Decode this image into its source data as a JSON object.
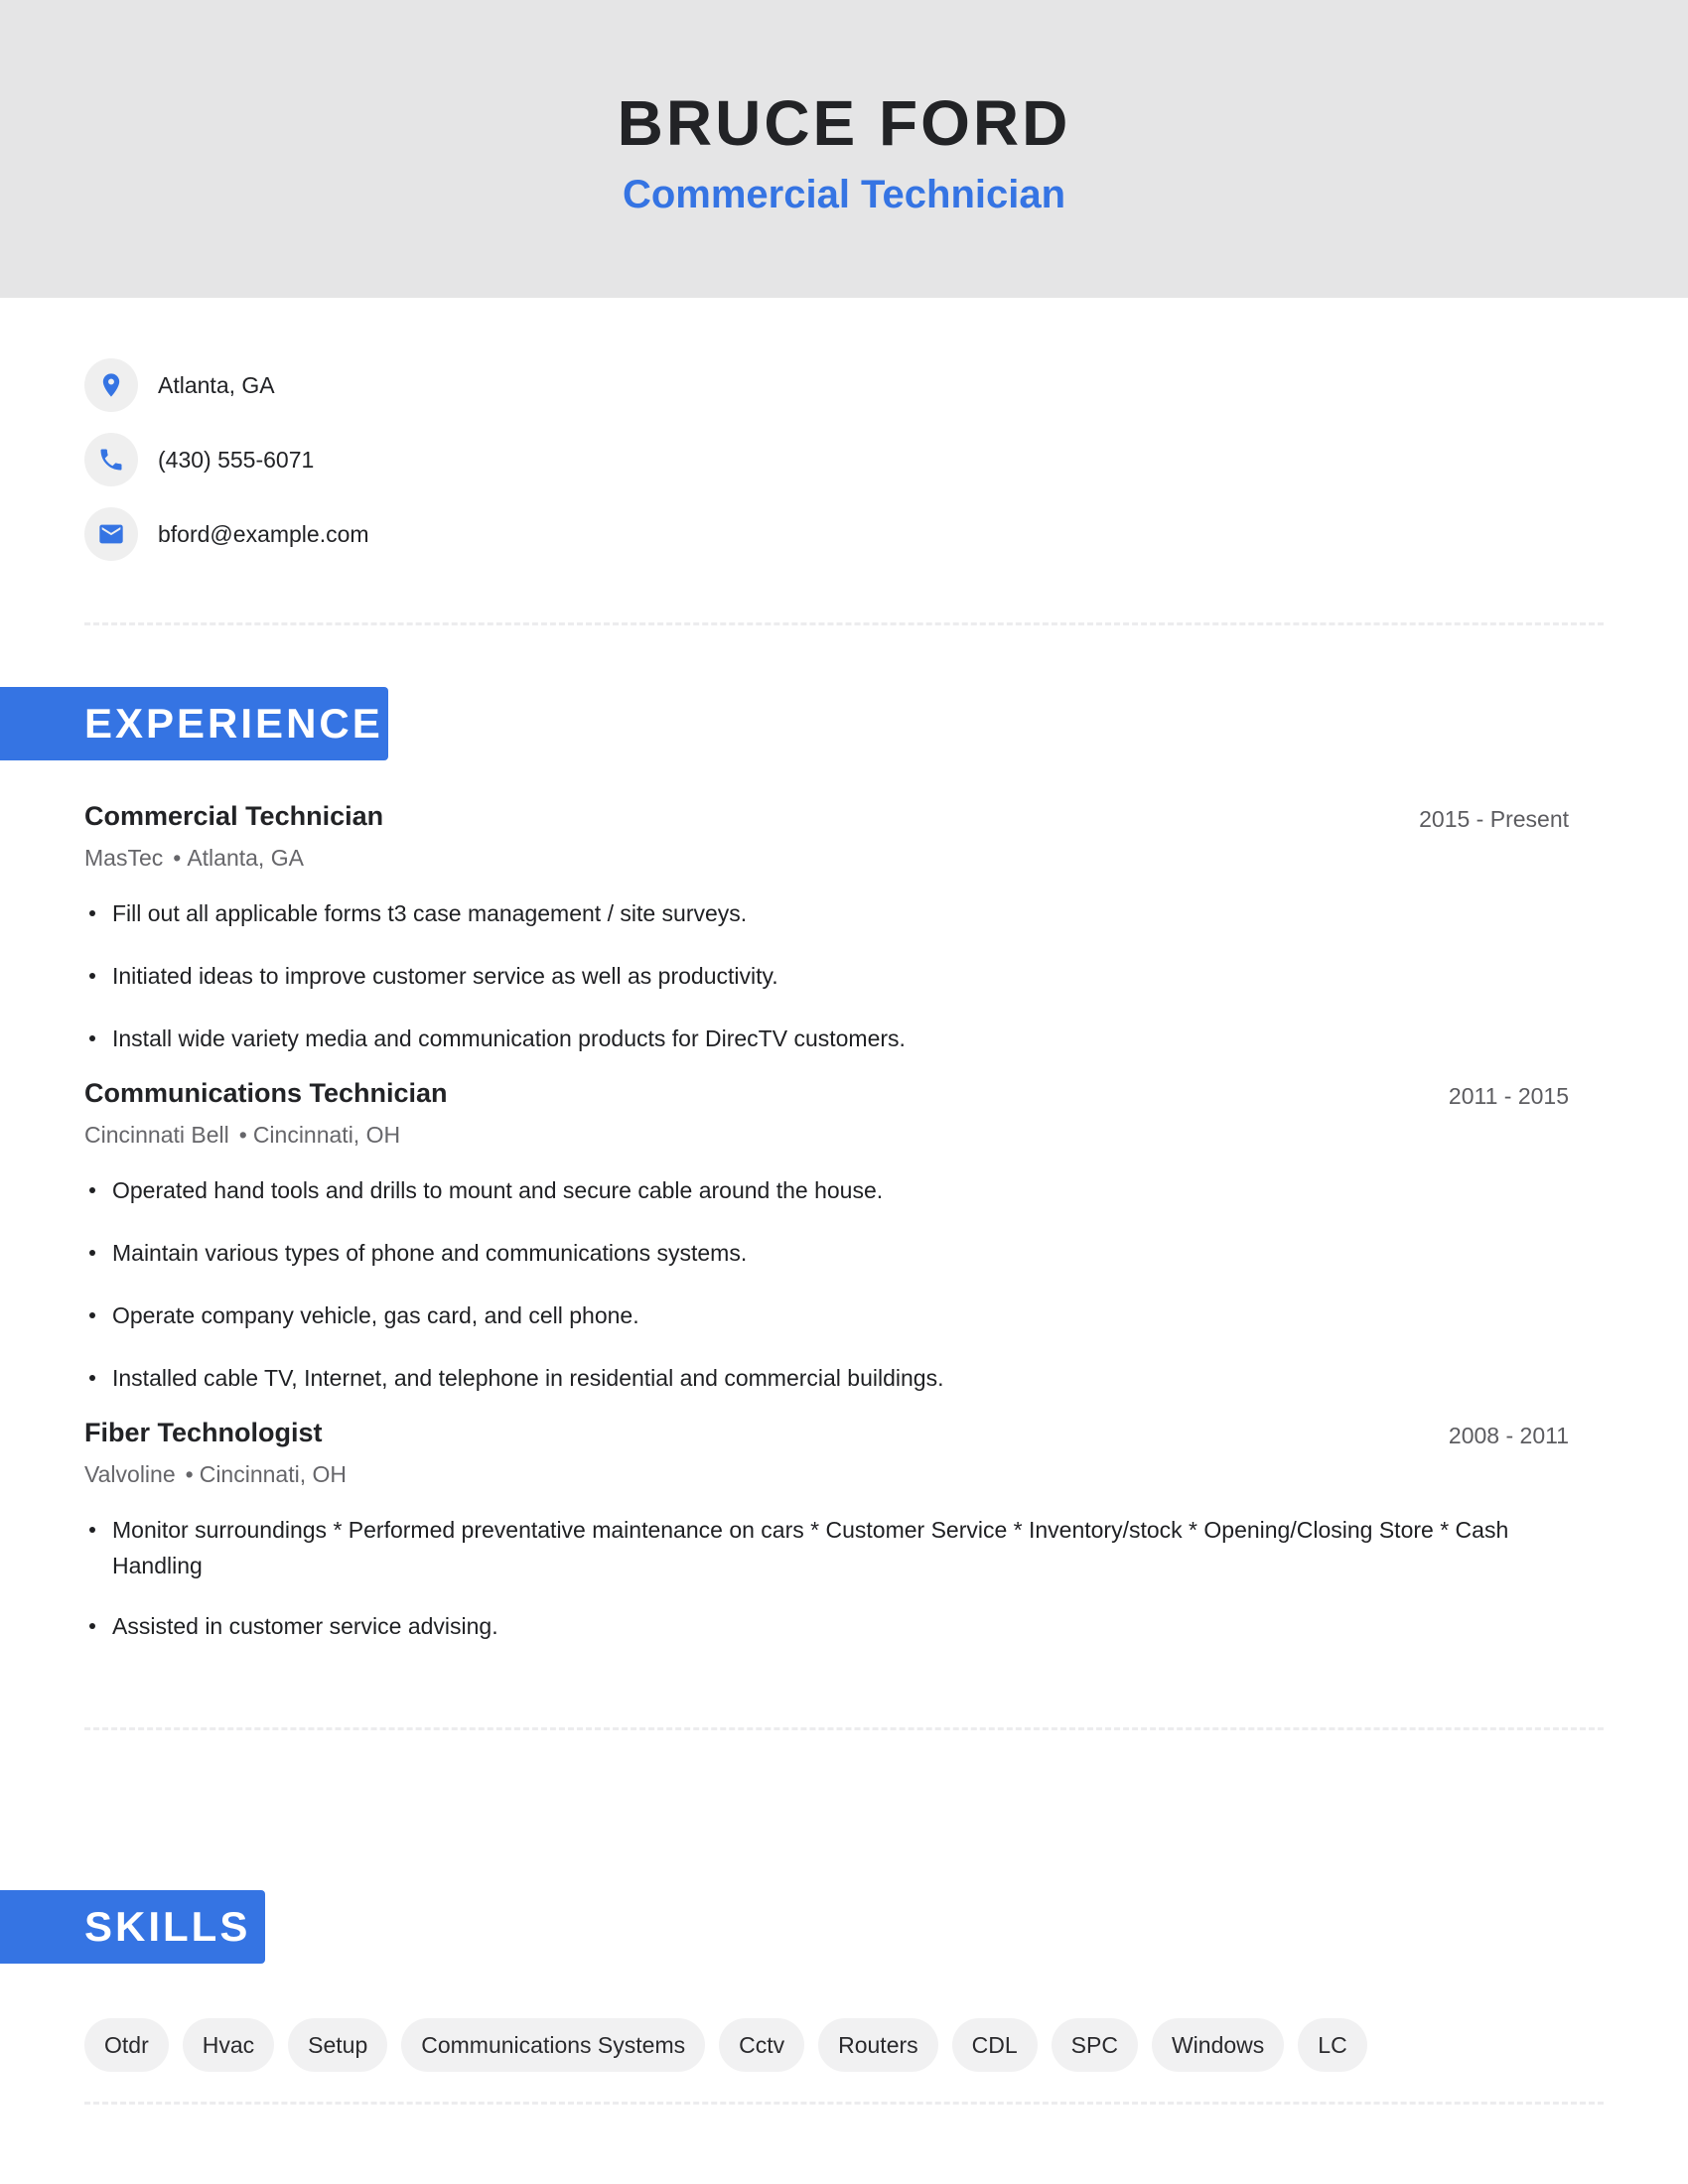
{
  "header": {
    "name": "BRUCE FORD",
    "title": "Commercial Technician"
  },
  "contact": {
    "location": "Atlanta, GA",
    "phone": "(430) 555-6071",
    "email": "bford@example.com"
  },
  "sections": {
    "experience": "EXPERIENCE",
    "skills": "SKILLS"
  },
  "experience": [
    {
      "title": "Commercial Technician",
      "dates": "2015 - Present",
      "company": "MasTec",
      "location": "Atlanta, GA",
      "bullets": [
        "Fill out all applicable forms t3 case management / site surveys.",
        "Initiated ideas to improve customer service as well as productivity.",
        "Install wide variety media and communication products for DirecTV customers."
      ]
    },
    {
      "title": "Communications Technician",
      "dates": "2011 - 2015",
      "company": "Cincinnati Bell",
      "location": "Cincinnati, OH",
      "bullets": [
        "Operated hand tools and drills to mount and secure cable around the house.",
        "Maintain various types of phone and communications systems.",
        "Operate company vehicle, gas card, and cell phone.",
        "Installed cable TV, Internet, and telephone in residential and commercial buildings."
      ]
    },
    {
      "title": "Fiber Technologist",
      "dates": "2008 - 2011",
      "company": "Valvoline",
      "location": "Cincinnati, OH",
      "bullets": [
        "Monitor surroundings * Performed preventative maintenance on cars * Customer Service * Inventory/stock * Opening/Closing Store * Cash Handling",
        "Assisted in customer service advising."
      ]
    }
  ],
  "skills": [
    "Otdr",
    "Hvac",
    "Setup",
    "Communications Systems",
    "Cctv",
    "Routers",
    "CDL",
    "SPC",
    "Windows",
    "LC"
  ],
  "colors": {
    "accent": "#3574e3",
    "header_bg": "#e5e5e6",
    "pill_bg": "#f1f1f2",
    "text": "#222326"
  },
  "icons": {
    "location": "map-pin-icon",
    "phone": "phone-icon",
    "email": "mail-icon"
  }
}
